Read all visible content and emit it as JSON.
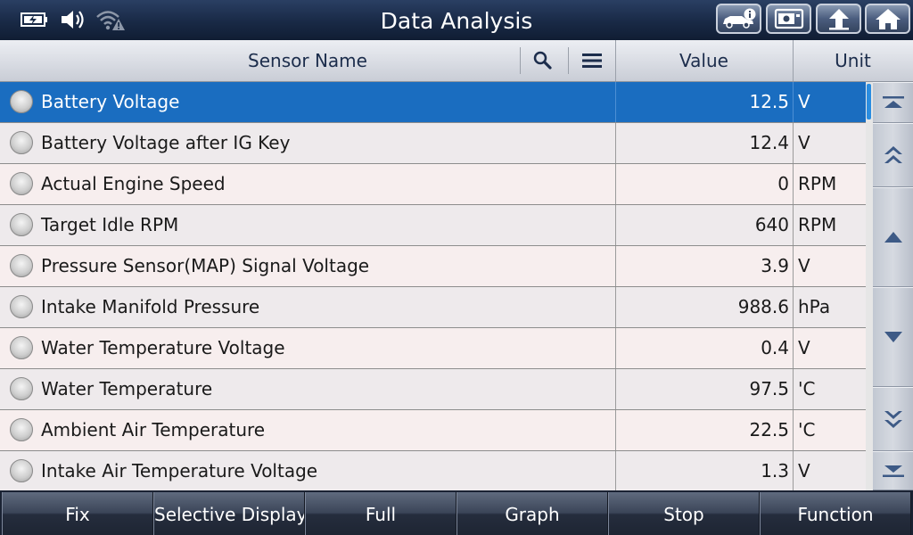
{
  "header": {
    "title": "Data Analysis",
    "status_icons": [
      "battery-charging-icon",
      "speaker-icon",
      "wifi-warning-icon"
    ],
    "buttons": [
      "vehicle-info-icon",
      "screen-capture-icon",
      "back-icon",
      "home-icon"
    ]
  },
  "table": {
    "columns": {
      "sensor": "Sensor Name",
      "value": "Value",
      "unit": "Unit"
    },
    "selected_index": 0,
    "rows": [
      {
        "name": "Battery Voltage",
        "value": "12.5",
        "unit": "V"
      },
      {
        "name": "Battery Voltage after IG Key",
        "value": "12.4",
        "unit": "V"
      },
      {
        "name": "Actual Engine Speed",
        "value": "0",
        "unit": "RPM"
      },
      {
        "name": "Target Idle RPM",
        "value": "640",
        "unit": "RPM"
      },
      {
        "name": "Pressure Sensor(MAP) Signal Voltage",
        "value": "3.9",
        "unit": "V"
      },
      {
        "name": "Intake Manifold Pressure",
        "value": "988.6",
        "unit": "hPa"
      },
      {
        "name": "Water Temperature Voltage",
        "value": "0.4",
        "unit": "V"
      },
      {
        "name": "Water Temperature",
        "value": "97.5",
        "unit": "'C"
      },
      {
        "name": "Ambient Air Temperature",
        "value": "22.5",
        "unit": "'C"
      },
      {
        "name": "Intake Air Temperature Voltage",
        "value": "1.3",
        "unit": "V"
      }
    ]
  },
  "side_buttons": [
    "scroll-top-icon",
    "page-up-icon",
    "line-up-icon",
    "line-down-icon",
    "page-down-icon",
    "scroll-bottom-icon"
  ],
  "toolbar": {
    "fix": "Fix",
    "selective": "Selective Display",
    "full": "Full",
    "graph": "Graph",
    "stop": "Stop",
    "function": "Function"
  },
  "colors": {
    "selected_row": "#1a6dc0",
    "title_bar": "#1a2b48",
    "accent_scroll": "#2a8de0"
  }
}
